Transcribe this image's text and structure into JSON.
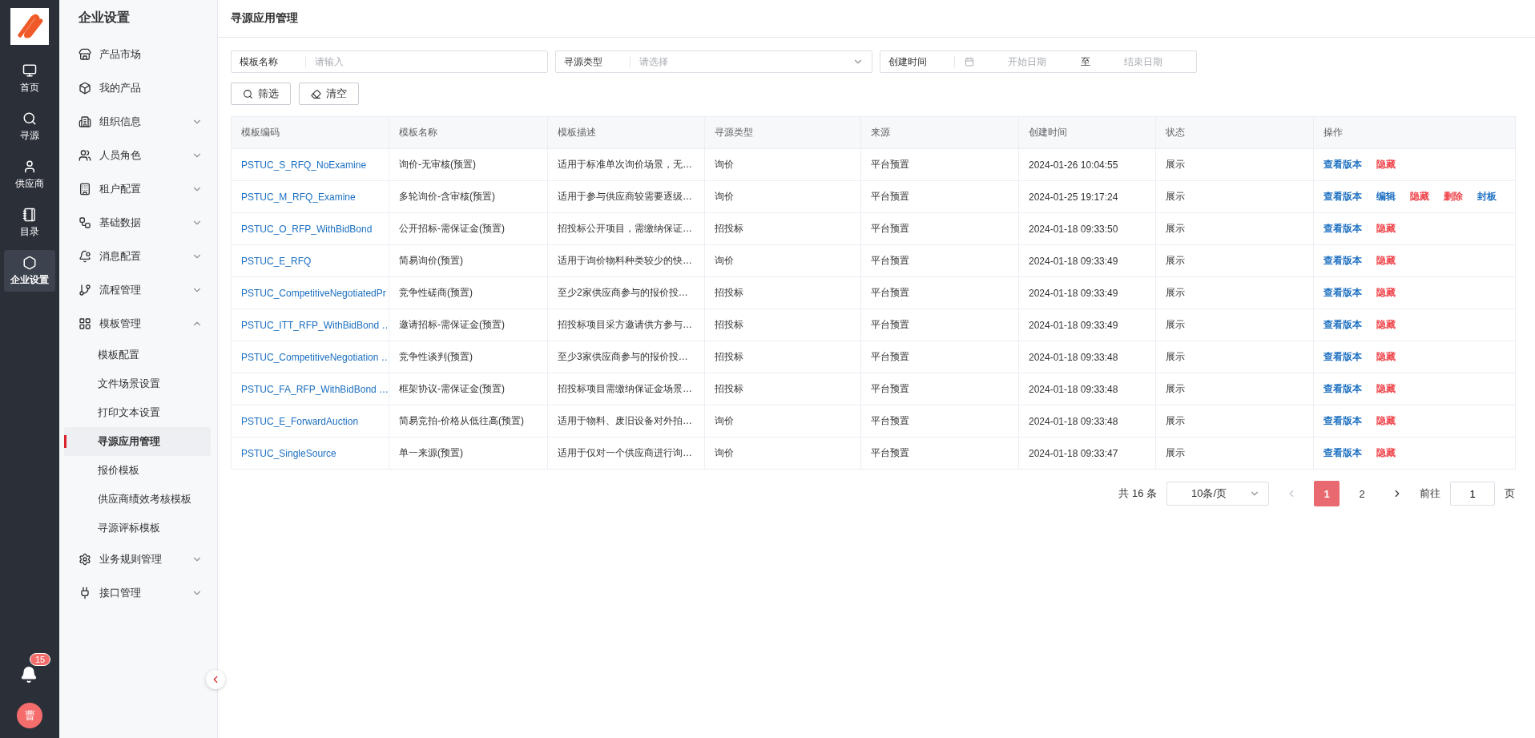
{
  "rail": {
    "items": [
      {
        "label": "首页",
        "selected": false
      },
      {
        "label": "寻源",
        "selected": false
      },
      {
        "label": "供应商",
        "selected": false
      },
      {
        "label": "目录",
        "selected": false
      },
      {
        "label": "企业设置",
        "selected": true
      }
    ]
  },
  "notifications": {
    "count": "15"
  },
  "avatar": {
    "initial": "曹"
  },
  "sidebar": {
    "title": "企业设置",
    "items": [
      {
        "label": "产品市场"
      },
      {
        "label": "我的产品"
      },
      {
        "label": "组织信息",
        "expanded": false
      },
      {
        "label": "人员角色",
        "expanded": false
      },
      {
        "label": "租户配置",
        "expanded": false
      },
      {
        "label": "基础数据",
        "expanded": false
      },
      {
        "label": "消息配置",
        "expanded": false
      },
      {
        "label": "流程管理",
        "expanded": false
      },
      {
        "label": "模板管理",
        "expanded": true,
        "children": [
          {
            "label": "模板配置",
            "selected": false
          },
          {
            "label": "文件场景设置",
            "selected": false
          },
          {
            "label": "打印文本设置",
            "selected": false
          },
          {
            "label": "寻源应用管理",
            "selected": true
          },
          {
            "label": "报价模板",
            "selected": false
          },
          {
            "label": "供应商绩效考核模板",
            "selected": false
          },
          {
            "label": "寻源评标模板",
            "selected": false
          }
        ]
      },
      {
        "label": "业务规则管理",
        "expanded": false
      },
      {
        "label": "接口管理",
        "expanded": false
      }
    ]
  },
  "page": {
    "title": "寻源应用管理"
  },
  "filters": [
    {
      "kind": "text",
      "label": "模板名称",
      "placeholder": "请输入"
    },
    {
      "kind": "select",
      "label": "寻源类型",
      "placeholder": "请选择"
    },
    {
      "kind": "daterange",
      "label": "创建时间",
      "placeholder": "开始日期",
      "separator": "至",
      "end_placeholder": "结束日期"
    }
  ],
  "buttons": [
    {
      "label": "筛选"
    },
    {
      "label": "清空"
    }
  ],
  "table": {
    "columns": [
      "模板编码",
      "模板名称",
      "模板描述",
      "寻源类型",
      "来源",
      "创建时间",
      "状态",
      "操作"
    ],
    "rows": [
      {
        "cells": [
          "PSTUC_S_RFQ_NoExamine",
          "询价-无审核(预置)",
          "适用于标准单次询价场景，无…",
          "询价",
          "平台预置",
          "2024-01-26 10:04:55",
          "展示"
        ],
        "actions": [
          {
            "label": "查看版本",
            "kind": "primary"
          },
          {
            "label": "隐藏",
            "kind": "danger"
          }
        ]
      },
      {
        "cells": [
          "PSTUC_M_RFQ_Examine",
          "多轮询价-含审核(预置)",
          "适用于参与供应商较需要逐级…",
          "询价",
          "平台预置",
          "2024-01-25 19:17:24",
          "展示"
        ],
        "actions": [
          {
            "label": "查看版本",
            "kind": "primary"
          },
          {
            "label": "编辑",
            "kind": "primary"
          },
          {
            "label": "隐藏",
            "kind": "danger"
          },
          {
            "label": "删除",
            "kind": "danger"
          },
          {
            "label": "封板",
            "kind": "primary"
          }
        ]
      },
      {
        "cells": [
          "PSTUC_O_RFP_WithBidBond",
          "公开招标-需保证金(预置)",
          "招投标公开项目，需缴纳保证…",
          "招投标",
          "平台预置",
          "2024-01-18 09:33:50",
          "展示"
        ],
        "actions": [
          {
            "label": "查看版本",
            "kind": "primary"
          },
          {
            "label": "隐藏",
            "kind": "danger"
          }
        ]
      },
      {
        "cells": [
          "PSTUC_E_RFQ",
          "简易询价(预置)",
          "适用于询价物料种类较少的快…",
          "询价",
          "平台预置",
          "2024-01-18 09:33:49",
          "展示"
        ],
        "actions": [
          {
            "label": "查看版本",
            "kind": "primary"
          },
          {
            "label": "隐藏",
            "kind": "danger"
          }
        ]
      },
      {
        "cells": [
          "PSTUC_CompetitiveNegotiatedPr",
          "竞争性磋商(预置)",
          "至少2家供应商参与的报价投…",
          "招投标",
          "平台预置",
          "2024-01-18 09:33:49",
          "展示"
        ],
        "actions": [
          {
            "label": "查看版本",
            "kind": "primary"
          },
          {
            "label": "隐藏",
            "kind": "danger"
          }
        ]
      },
      {
        "cells": [
          "PSTUC_ITT_RFP_WithBidBond …",
          "邀请招标-需保证金(预置)",
          "招投标项目采方邀请供方参与…",
          "招投标",
          "平台预置",
          "2024-01-18 09:33:49",
          "展示"
        ],
        "actions": [
          {
            "label": "查看版本",
            "kind": "primary"
          },
          {
            "label": "隐藏",
            "kind": "danger"
          }
        ]
      },
      {
        "cells": [
          "PSTUC_CompetitiveNegotiation …",
          "竞争性谈判(预置)",
          "至少3家供应商参与的报价投…",
          "招投标",
          "平台预置",
          "2024-01-18 09:33:48",
          "展示"
        ],
        "actions": [
          {
            "label": "查看版本",
            "kind": "primary"
          },
          {
            "label": "隐藏",
            "kind": "danger"
          }
        ]
      },
      {
        "cells": [
          "PSTUC_FA_RFP_WithBidBond …",
          "框架协议-需保证金(预置)",
          "招投标项目需缴纳保证金场景…",
          "招投标",
          "平台预置",
          "2024-01-18 09:33:48",
          "展示"
        ],
        "actions": [
          {
            "label": "查看版本",
            "kind": "primary"
          },
          {
            "label": "隐藏",
            "kind": "danger"
          }
        ]
      },
      {
        "cells": [
          "PSTUC_E_ForwardAuction",
          "简易竞拍-价格从低往高(预置)",
          "适用于物料、废旧设备对外拍…",
          "询价",
          "平台预置",
          "2024-01-18 09:33:48",
          "展示"
        ],
        "actions": [
          {
            "label": "查看版本",
            "kind": "primary"
          },
          {
            "label": "隐藏",
            "kind": "danger"
          }
        ]
      },
      {
        "cells": [
          "PSTUC_SingleSource",
          "单一来源(预置)",
          "适用于仅对一个供应商进行询…",
          "询价",
          "平台预置",
          "2024-01-18 09:33:47",
          "展示"
        ],
        "actions": [
          {
            "label": "查看版本",
            "kind": "primary"
          },
          {
            "label": "隐藏",
            "kind": "danger"
          }
        ]
      }
    ]
  },
  "pagination": {
    "total": "共 16 条",
    "page_size": "10条/页",
    "prev_disabled": true,
    "next_disabled": false,
    "pages": [
      {
        "label": "1",
        "selected": true
      },
      {
        "label": "2",
        "selected": false
      }
    ],
    "goto_label": "前往",
    "goto_value": "1",
    "page_unit": "页"
  }
}
